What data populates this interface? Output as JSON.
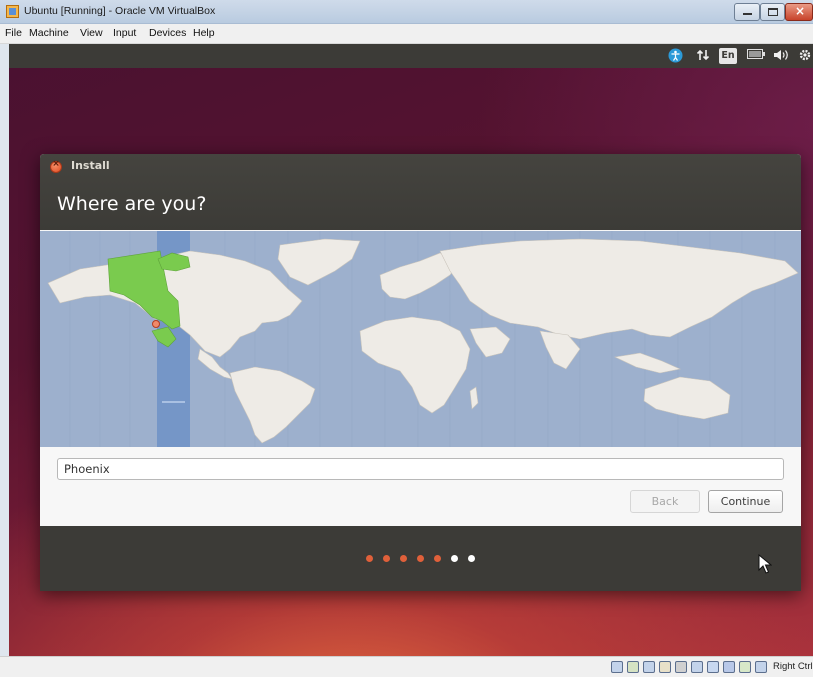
{
  "window": {
    "title": "Ubuntu [Running] - Oracle VM VirtualBox",
    "menu": [
      "File",
      "Machine",
      "View",
      "Input",
      "Devices",
      "Help"
    ]
  },
  "top_panel": {
    "indicators": [
      "accessibility-icon",
      "network-icon",
      "keyboard-layout-indicator",
      "battery-icon",
      "volume-icon",
      "settings-gear-icon"
    ],
    "keyboard_layout": "En"
  },
  "installer": {
    "window_title": "Install",
    "heading": "Where are you?",
    "location_value": "Phoenix",
    "back_label": "Back",
    "continue_label": "Continue",
    "progress": {
      "completed_steps": 5,
      "total_steps": 7
    }
  },
  "statusbar": {
    "host_key": "Right Ctrl",
    "icons": [
      "hard-disk-icon",
      "optical-drive-icon",
      "network-adapter-icon",
      "usb-icon",
      "shared-folders-icon",
      "display-icon",
      "video-capture-icon",
      "cpu-icon",
      "mouse-integration-icon",
      "host-key-icon"
    ]
  },
  "colors": {
    "selected_timezone": "#7acb4e",
    "timezone_band": "#6f92c5",
    "progress_done": "#e0603a",
    "progress_todo": "#ffffff",
    "ubuntu_panel": "#3c3b37"
  }
}
